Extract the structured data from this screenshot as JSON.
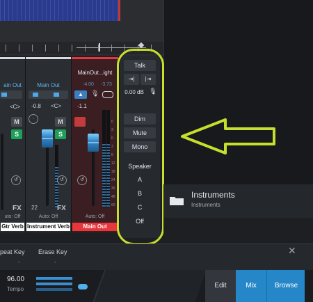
{
  "channels": [
    {
      "route": "ain Out",
      "value": "",
      "auto": "uto: Off",
      "label": "Gtr Verb",
      "label_color": "#ffffff",
      "fx": "FX"
    },
    {
      "route": "Main Out",
      "value": "-0.8",
      "pan": "<C>",
      "auto": "Auto: Off",
      "label": "Instrument Verb",
      "label_color": "#ffffff",
      "number": "22",
      "fx": "FX"
    },
    {
      "name": "MainOut...ight",
      "value": "-1.1",
      "readout1": "-4.00",
      "readout2": "-3.73",
      "auto": "Auto: Off",
      "label": "Main Out",
      "label_color": "#e8363d"
    }
  ],
  "pan_left": "<C>",
  "mute_label": "M",
  "solo_label": "S",
  "control_room": {
    "talk": "Talk",
    "gain": "0.00 dB",
    "dim": "Dim",
    "mute": "Mute",
    "mono": "Mono",
    "speaker": "Speaker",
    "speakers": [
      "A",
      "B",
      "C",
      "Off"
    ]
  },
  "browser": {
    "title": "Instruments",
    "subtitle": "Instruments"
  },
  "keys": {
    "repeat": "peat Key",
    "erase": "Erase Key",
    "dots": "-"
  },
  "tempo": {
    "value": "96.00",
    "label": "Tempo"
  },
  "tabs": {
    "edit": "Edit",
    "mix": "Mix",
    "browse": "Browse"
  },
  "close": "✕",
  "colors": {
    "highlight": "#c6df2c",
    "accent": "#2586c8",
    "solo": "#1fa05a",
    "main_out": "#e8363d"
  },
  "meter_scale": [
    "6",
    "3",
    "0",
    "3",
    "6",
    "12",
    "18",
    "24",
    "36",
    "48",
    "60"
  ]
}
